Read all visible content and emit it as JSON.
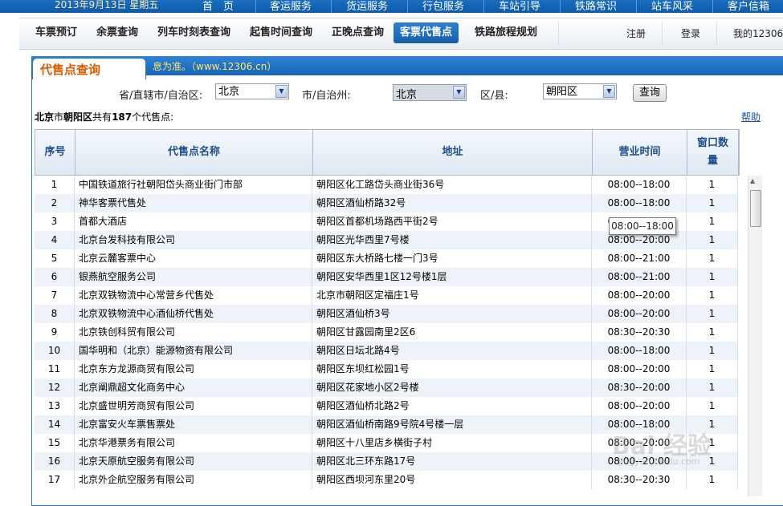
{
  "topbar": {
    "date": "2013年9月13日 星期五",
    "nav": [
      "首　页",
      "客运服务",
      "货运服务",
      "行包服务",
      "车站引导",
      "铁路常识",
      "站车风采",
      "客户信箱"
    ]
  },
  "nav2": {
    "items": [
      "车票预订",
      "余票查询",
      "列车时刻表查询",
      "起售时间查询",
      "正晚点查询",
      "客票代售点",
      "铁路旅程规划"
    ],
    "active_index": 5,
    "right_links": [
      "注册",
      "登录",
      "我的12306"
    ]
  },
  "panel": {
    "title": "代售点查询",
    "marquee": "息为准。（www.12306.cn）"
  },
  "query": {
    "province_label": "省/直辖市/自治区:",
    "province_value": "北京",
    "city_label": "市/自治州:",
    "city_value": "北京",
    "district_label": "区/县:",
    "district_value": "朝阳区",
    "button": "查询"
  },
  "summary": {
    "prefix": "北京",
    "mid1": "市",
    "district": "朝阳区",
    "mid2": "共有",
    "count": "187",
    "suffix": "个代售点:"
  },
  "help": "帮助",
  "table": {
    "headers": [
      "序号",
      "代售点名称",
      "地址",
      "营业时间",
      "窗口数量"
    ],
    "rows": [
      {
        "no": "1",
        "name": "中国铁道旅行社朝阳岱头商业街门市部",
        "addr": "朝阳区化工路岱头商业街36号",
        "hours": "08:00--18:00",
        "win": "1"
      },
      {
        "no": "2",
        "name": "神华客票代售处",
        "addr": "朝阳区酒仙桥路32号",
        "hours": "08:00--18:00",
        "win": "1"
      },
      {
        "no": "3",
        "name": "首都大酒店",
        "addr": "朝阳区首都机场路西平街2号",
        "hours": "08:00--18:00",
        "win": "1"
      },
      {
        "no": "4",
        "name": "北京台发科技有限公司",
        "addr": "朝阳区光华西里7号楼",
        "hours": "08:00--20:00",
        "win": "1"
      },
      {
        "no": "5",
        "name": "北京云麓客票中心",
        "addr": "朝阳区东大桥路七楼一门3号",
        "hours": "08:00--21:00",
        "win": "1"
      },
      {
        "no": "6",
        "name": "银燕航空服务公司",
        "addr": "朝阳区安华西里1区12号楼1层",
        "hours": "08:00--21:00",
        "win": "1"
      },
      {
        "no": "7",
        "name": "北京双铁物流中心常营乡代售处",
        "addr": "北京市朝阳区定福庄1号",
        "hours": "08:00--20:00",
        "win": "1"
      },
      {
        "no": "8",
        "name": "北京双铁物流中心酒仙桥代售处",
        "addr": "朝阳区酒仙桥3号",
        "hours": "08:00--20:00",
        "win": "1"
      },
      {
        "no": "9",
        "name": "北京铁创科贸有限公司",
        "addr": "朝阳区甘露园南里2区6",
        "hours": "08:30--20:30",
        "win": "1"
      },
      {
        "no": "10",
        "name": "国华明和（北京）能源物资有限公司",
        "addr": "朝阳区日坛北路4号",
        "hours": "08:00--18:00",
        "win": "1"
      },
      {
        "no": "11",
        "name": "北京东方龙源商贸有限公司",
        "addr": "朝阳区东坝红松园1号",
        "hours": "08:00--20:00",
        "win": "1"
      },
      {
        "no": "12",
        "name": "北京阐鼎超文化商务中心",
        "addr": "朝阳区花家地小区2号楼",
        "hours": "08:30--20:00",
        "win": "1"
      },
      {
        "no": "13",
        "name": "北京盛世明芳商贸有限公司",
        "addr": "朝阳区酒仙桥北路2号",
        "hours": "08:00--20:00",
        "win": "1"
      },
      {
        "no": "14",
        "name": "北京富安火车票售票处",
        "addr": "朝阳区酒仙桥南路9号院4号楼一层",
        "hours": "08:00--18:00",
        "win": "1"
      },
      {
        "no": "15",
        "name": "北京华港票务有限公司",
        "addr": "朝阳区十八里店乡横街子村",
        "hours": "08:00--20:00",
        "win": "1"
      },
      {
        "no": "16",
        "name": "北京天原航空服务有限公司",
        "addr": "朝阳区北三环东路17号",
        "hours": "08:00--20:00",
        "win": "1"
      },
      {
        "no": "17",
        "name": "北京外企航空服务有限公司",
        "addr": "朝阳区西坝河东里20号",
        "hours": "08:30--20:30",
        "win": "1"
      }
    ]
  },
  "tooltip": "08:00--18:00",
  "watermark": "Bai 经验",
  "watermark_url": "jingyan.baidu.com"
}
